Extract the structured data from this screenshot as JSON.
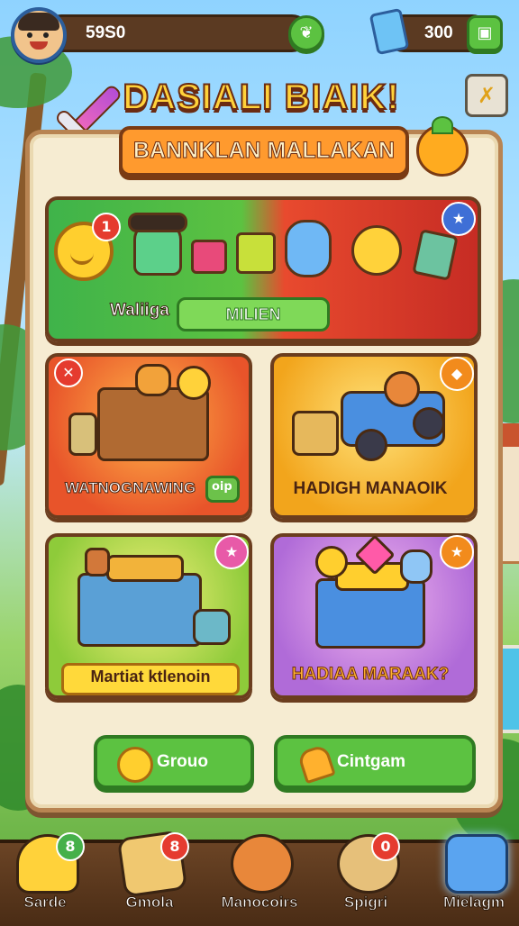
{
  "header": {
    "coins": "59S0",
    "gems": "300",
    "coins_add_icon": "leaf-icon",
    "gems_add_icon": "plus-icon"
  },
  "title": "DASIALI BIAIK!",
  "subtitle": "BANNKLAN MALLAKAN",
  "banner": {
    "label": "Waliiga",
    "button_label": "MILIEN",
    "coin_badge": "1"
  },
  "cards": [
    {
      "label": "WATNOGNAWING",
      "tag": "oip",
      "corner_icon": "close-icon"
    },
    {
      "label": "HADIGH MANAOIK",
      "corner_icon": "diamond-icon"
    },
    {
      "label": "Martiat ktlenoin",
      "corner_icon": "star-icon"
    },
    {
      "label": "HADIAA MARAAK?",
      "corner_icon": "star-icon"
    }
  ],
  "actions": [
    {
      "label": "Grouo",
      "icon": "coin-icon"
    },
    {
      "label": "Cintgam",
      "icon": "bell-icon"
    }
  ],
  "nav": [
    {
      "label": "Sarde",
      "icon": "star-icon",
      "badge": "8"
    },
    {
      "label": "Gmola",
      "icon": "map-icon",
      "badge": "8"
    },
    {
      "label": "Manocoirs",
      "icon": "character-icon",
      "badge": ""
    },
    {
      "label": "Spigri",
      "icon": "coin-icon",
      "badge": "0"
    },
    {
      "label": "Mielagm",
      "icon": "star-shard-icon",
      "badge": ""
    }
  ],
  "colors": {
    "accent_green": "#5cc241",
    "accent_red": "#e53b2f",
    "title_yellow": "#ffd23a",
    "panel": "#f6ecd2"
  }
}
